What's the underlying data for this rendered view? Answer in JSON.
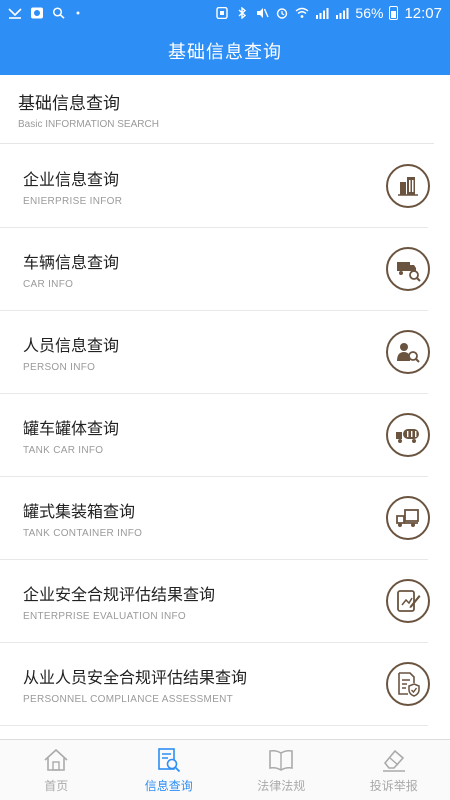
{
  "status_bar": {
    "battery": "56%",
    "time": "12:07"
  },
  "header": {
    "title": "基础信息查询"
  },
  "section": {
    "title_cn": "基础信息查询",
    "title_en": "Basic INFORMATION SEARCH"
  },
  "items": [
    {
      "cn": "企业信息查询",
      "en": "ENIERPRISE INFOR",
      "icon": "building-icon"
    },
    {
      "cn": "车辆信息查询",
      "en": "CAR INFO",
      "icon": "truck-search-icon"
    },
    {
      "cn": "人员信息查询",
      "en": "PERSON INFO",
      "icon": "person-search-icon"
    },
    {
      "cn": "罐车罐体查询",
      "en": "TANK CAR INFO",
      "icon": "tank-truck-icon"
    },
    {
      "cn": "罐式集装箱查询",
      "en": "TANK CONTAINER INFO",
      "icon": "container-truck-icon"
    },
    {
      "cn": "企业安全合规评估结果查询",
      "en": "ENTERPRISE EVALUATION INFO",
      "icon": "edit-document-icon"
    },
    {
      "cn": "从业人员安全合规评估结果查询",
      "en": "PERSONNEL COMPLIANCE ASSESSMENT",
      "icon": "shield-document-icon"
    }
  ],
  "nav": [
    {
      "label": "首页",
      "icon": "home-icon",
      "active": false
    },
    {
      "label": "信息查询",
      "icon": "info-search-icon",
      "active": true
    },
    {
      "label": "法律法规",
      "icon": "book-icon",
      "active": false
    },
    {
      "label": "投诉举报",
      "icon": "eraser-icon",
      "active": false
    }
  ],
  "colors": {
    "primary": "#2d8ef5",
    "icon_brown": "#6a5440",
    "nav_inactive": "#aaaaaa"
  }
}
